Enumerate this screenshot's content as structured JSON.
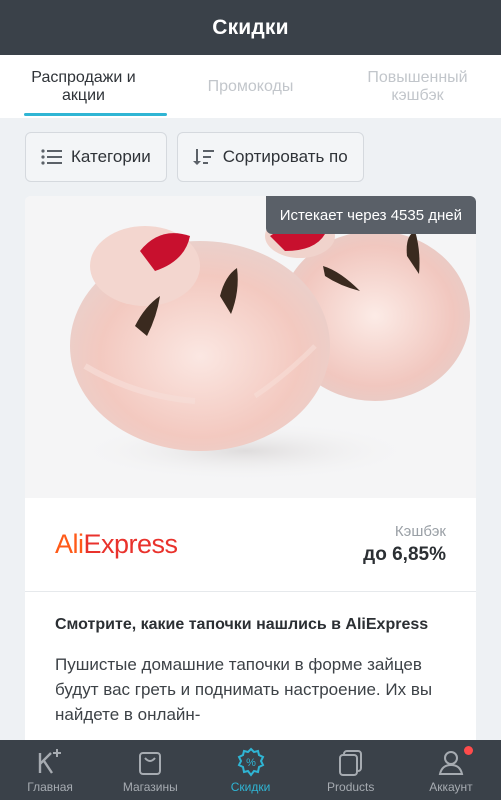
{
  "header": {
    "title": "Скидки"
  },
  "tabs": [
    {
      "label": "Распродажи и акции",
      "active": true
    },
    {
      "label": "Промокоды",
      "active": false
    },
    {
      "label": "Повышенный кэшбэк",
      "active": false
    }
  ],
  "filters": {
    "categories_label": "Категории",
    "sort_label": "Сортировать по"
  },
  "deal": {
    "expire_text": "Истекает через 4535 дней",
    "store_logo_ali": "Ali",
    "store_logo_express": "Express",
    "cashback_label": "Кэшбэк",
    "cashback_value": "до 6,85%",
    "title": "Смотрите, какие тапочки нашлись в AliExpress",
    "description": "Пушистые домашние тапочки в форме зайцев будут вас греть и поднимать настроение. Их вы найдете в онлайн-"
  },
  "nav": [
    {
      "label": "Главная",
      "icon": "home-k-icon",
      "active": false
    },
    {
      "label": "Магазины",
      "icon": "shopping-bag-icon",
      "active": false
    },
    {
      "label": "Скидки",
      "icon": "discount-badge-icon",
      "active": true
    },
    {
      "label": "Products",
      "icon": "products-icon",
      "active": false
    },
    {
      "label": "Аккаунт",
      "icon": "account-icon",
      "active": false,
      "notification": true
    }
  ],
  "colors": {
    "accent": "#2fb5d4",
    "header_bg": "#3a4149",
    "badge_bg": "#5a6068",
    "aliexpress_orange": "#ff5a18",
    "aliexpress_red": "#e9322c",
    "notification": "#ff4b4b"
  }
}
